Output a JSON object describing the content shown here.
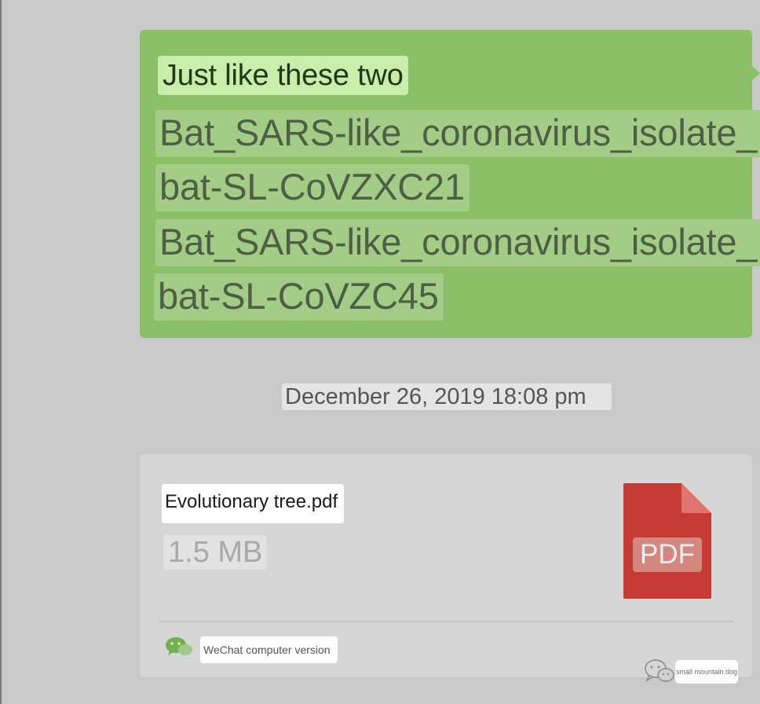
{
  "chat": {
    "sent_message": {
      "lines": [
        "Just like these two",
        "Bat_SARS-like_coronavirus_isolate_",
        "bat-SL-CoVZXC21",
        "Bat_SARS-like_coronavirus_isolate_",
        "bat-SL-CoVZC45"
      ],
      "bubble_color": "#8cc066"
    },
    "timestamp": "December 26, 2019 18:08 pm",
    "file_message": {
      "file_name": "Evolutionary tree.pdf",
      "file_size": "1.5 MB",
      "file_type_label": "PDF",
      "icon": "pdf-file-icon",
      "icon_color": "#c53a35",
      "source_icon": "wechat-icon",
      "source_label": "WeChat computer version"
    }
  },
  "watermark": {
    "icon": "wechat-logo-icon",
    "label": "small mountain dog"
  }
}
